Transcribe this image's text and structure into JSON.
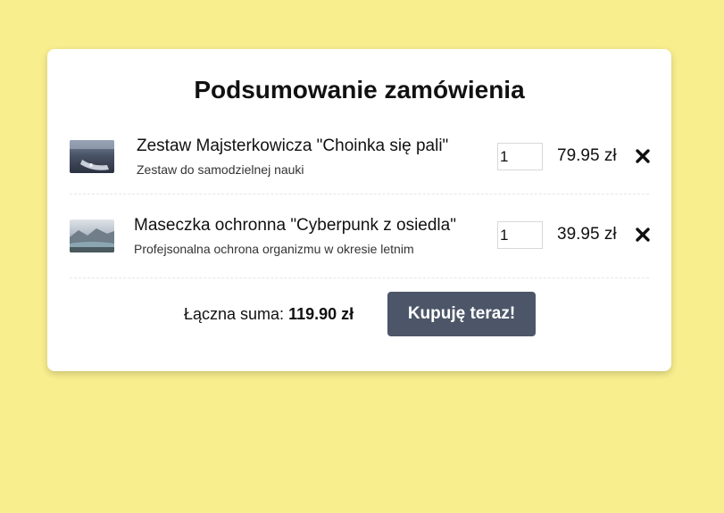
{
  "page": {
    "title": "Podsumowanie zamówienia"
  },
  "items": [
    {
      "name": "Zestaw Majsterkowicza \"Choinka się pali\"",
      "description": "Zestaw do samodzielnej nauki",
      "quantity": "1",
      "price": "79.95 zł",
      "thumbnail_icon": "product-photo-kit",
      "remove_icon": "close-icon"
    },
    {
      "name": "Maseczka ochronna \"Cyberpunk z osiedla\"",
      "description": "Profejsonalna ochrona organizmu w okresie letnim",
      "quantity": "1",
      "price": "39.95 zł",
      "thumbnail_icon": "product-photo-landscape",
      "remove_icon": "close-icon"
    }
  ],
  "summary": {
    "total_label": "Łączna suma:",
    "total_value": "119.90 zł",
    "buy_label": "Kupuję teraz!"
  },
  "colors": {
    "background": "#f8ee8e",
    "card": "#ffffff",
    "button": "#4c5668",
    "button_text": "#ffffff"
  }
}
